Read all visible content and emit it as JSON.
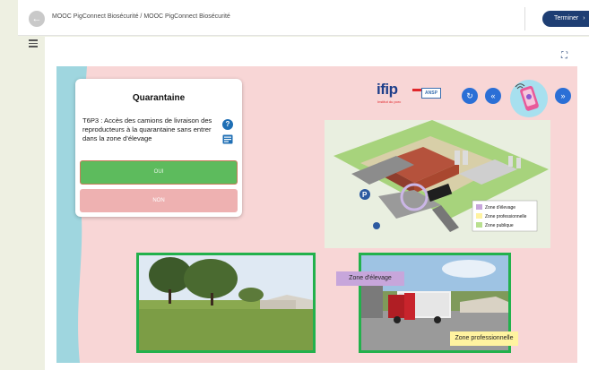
{
  "header": {
    "breadcrumb": "MOOC PigConnect Biosécurité / MOOC PigConnect Biosécurité",
    "finish_label": "Terminer",
    "back_icon": "back-arrow-icon",
    "finish_icon": "chevron-right-icon"
  },
  "sidebar": {
    "menu_icon": "hamburger-icon"
  },
  "toolbar": {
    "expand_icon": "fullscreen-icon"
  },
  "question": {
    "title": "Quarantaine",
    "text": "T6P3 : Accès des camions de livraison des reproducteurs à la quarantaine sans entrer dans la zone d'élevage",
    "yes_label": "OUI",
    "no_label": "NON",
    "help_icon": "help-icon",
    "doc_icon": "document-icon"
  },
  "logos": {
    "ifip": "ifip",
    "ifip_sub": "Institut du porc",
    "ansp": "ANSP"
  },
  "nav": {
    "replay_icon": "replay-icon",
    "prev_icon": "double-chevron-left-icon",
    "next_icon": "double-chevron-right-icon",
    "phone_icon": "phone-icon"
  },
  "map": {
    "parking": "P",
    "legend": [
      {
        "label": "Zone d'élevage",
        "color": "#c7a6db"
      },
      {
        "label": "Zone professionnelle",
        "color": "#fff3a0"
      },
      {
        "label": "Zone publique",
        "color": "#b9e08f"
      }
    ]
  },
  "photos": {
    "label_elevage": "Zone d'élevage",
    "label_pro": "Zone professionnelle"
  },
  "colors": {
    "accent": "#1e3e73",
    "stage_bg": "#f8d6d6",
    "yes_green": "#5dbb5d",
    "no_pink": "#eeb1b1",
    "frame_green": "#22b14c"
  }
}
